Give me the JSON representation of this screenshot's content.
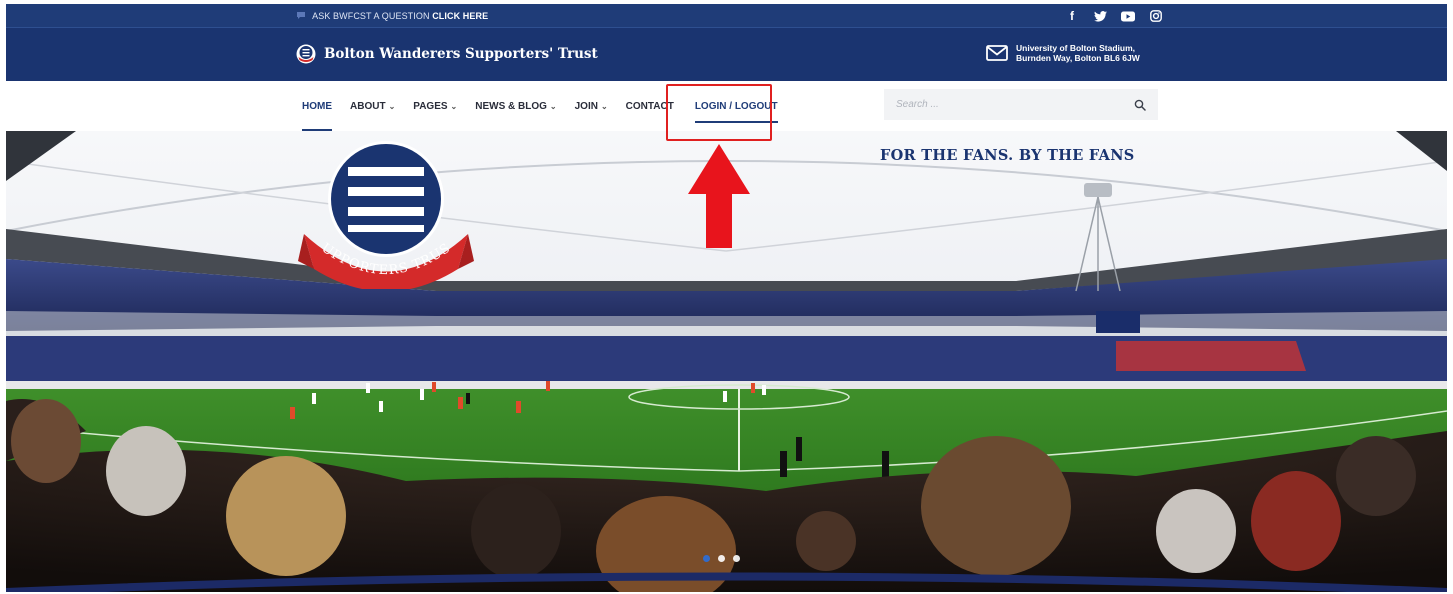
{
  "topbar": {
    "ask_prefix": "ASK BWFCST A QUESTION",
    "ask_link": "CLICK HERE",
    "socials": [
      {
        "name": "facebook-icon",
        "glyph": "f"
      },
      {
        "name": "twitter-icon",
        "glyph": "🐦"
      },
      {
        "name": "youtube-icon",
        "glyph": "▶"
      },
      {
        "name": "instagram-icon",
        "glyph": "◎"
      }
    ]
  },
  "brand": {
    "name": "Bolton Wanderers Supporters' Trust",
    "address_line1": "University of Bolton Stadium,",
    "address_line2": "Burnden Way, Bolton BL6 6JW"
  },
  "nav": {
    "items": [
      {
        "label": "HOME",
        "dropdown": false,
        "active": true
      },
      {
        "label": "ABOUT",
        "dropdown": true,
        "active": false
      },
      {
        "label": "PAGES",
        "dropdown": true,
        "active": false
      },
      {
        "label": "NEWS & BLOG",
        "dropdown": true,
        "active": false
      },
      {
        "label": "JOIN",
        "dropdown": true,
        "active": false
      },
      {
        "label": "CONTACT",
        "dropdown": false,
        "active": false
      }
    ],
    "login_label": "LOGIN / LOGOUT"
  },
  "search": {
    "placeholder": "Search ..."
  },
  "hero": {
    "tagline": "FOR THE FANS. BY THE FANS",
    "logo_banner": "SUPPORTERS TRUST",
    "slides": 3,
    "active_slide": 0
  },
  "colors": {
    "navy": "#1a3470",
    "accent": "#1f3c78",
    "highlight_red": "#e02020",
    "pitch_green": "#3f8f2a"
  }
}
